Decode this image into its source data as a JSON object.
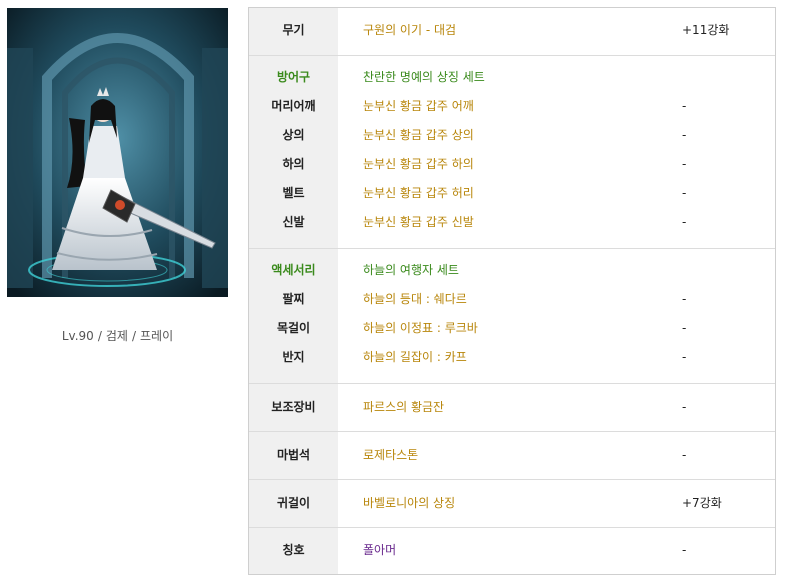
{
  "character": {
    "level": "Lv.90",
    "job": "검제",
    "name": "프레이"
  },
  "equipment": {
    "weapon": {
      "label": "무기",
      "item": "구원의 이기 - 대검",
      "enhance": "+11강화"
    },
    "armor": {
      "label": "방어구",
      "set_name": "찬란한 명예의 상징 세트",
      "rows": [
        {
          "label": "머리어깨",
          "item": "눈부신 황금 갑주 어깨",
          "enhance": "-"
        },
        {
          "label": "상의",
          "item": "눈부신 황금 갑주 상의",
          "enhance": "-"
        },
        {
          "label": "하의",
          "item": "눈부신 황금 갑주 하의",
          "enhance": "-"
        },
        {
          "label": "벨트",
          "item": "눈부신 황금 갑주 허리",
          "enhance": "-"
        },
        {
          "label": "신발",
          "item": "눈부신 황금 갑주 신발",
          "enhance": "-"
        }
      ]
    },
    "accessory": {
      "label": "액세서리",
      "set_name": "하늘의 여행자 세트",
      "rows": [
        {
          "label": "팔찌",
          "item": "하늘의 등대 : 쉐다르",
          "enhance": "-"
        },
        {
          "label": "목걸이",
          "item": "하늘의 이정표 : 루크바",
          "enhance": "-"
        },
        {
          "label": "반지",
          "item": "하늘의 길잡이 : 카프",
          "enhance": "-"
        }
      ]
    },
    "sub": {
      "label": "보조장비",
      "item": "파르스의 황금잔",
      "enhance": "-"
    },
    "magic_stone": {
      "label": "마법석",
      "item": "로제타스톤",
      "enhance": "-"
    },
    "earring": {
      "label": "귀걸이",
      "item": "바벨로니아의 상징",
      "enhance": "+7강화"
    },
    "title": {
      "label": "칭호",
      "item": "폴아머",
      "enhance": "-"
    }
  },
  "colors": {
    "item_gold": "#b8860b",
    "set_green": "#3a8a1c",
    "title_purple": "#6a2a8e",
    "label_bg": "#f0f0f0"
  }
}
